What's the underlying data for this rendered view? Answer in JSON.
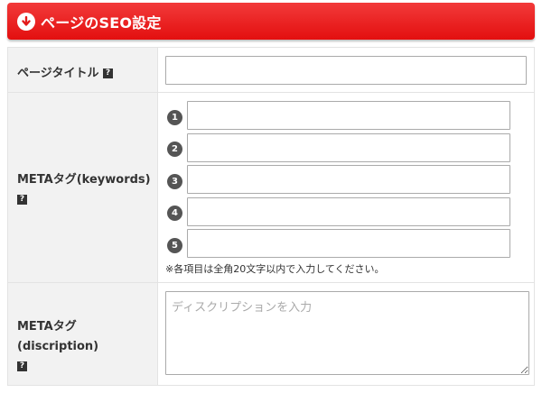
{
  "header": {
    "title": "ページのSEO設定",
    "icon": "arrow-down-circle-icon",
    "color": "#e71c1c"
  },
  "rows": {
    "title": {
      "label": "ページタイトル",
      "help": "?",
      "value": ""
    },
    "keywords": {
      "label": "METAタグ(keywords)",
      "help": "?",
      "numbers": [
        "1",
        "2",
        "3",
        "4",
        "5"
      ],
      "values": [
        "",
        "",
        "",
        "",
        ""
      ],
      "note": "※各項目は全角20文字以内で入力してください。"
    },
    "description": {
      "label": "METAタグ(discription)",
      "help": "?",
      "placeholder": "ディスクリプションを入力",
      "value": ""
    }
  }
}
